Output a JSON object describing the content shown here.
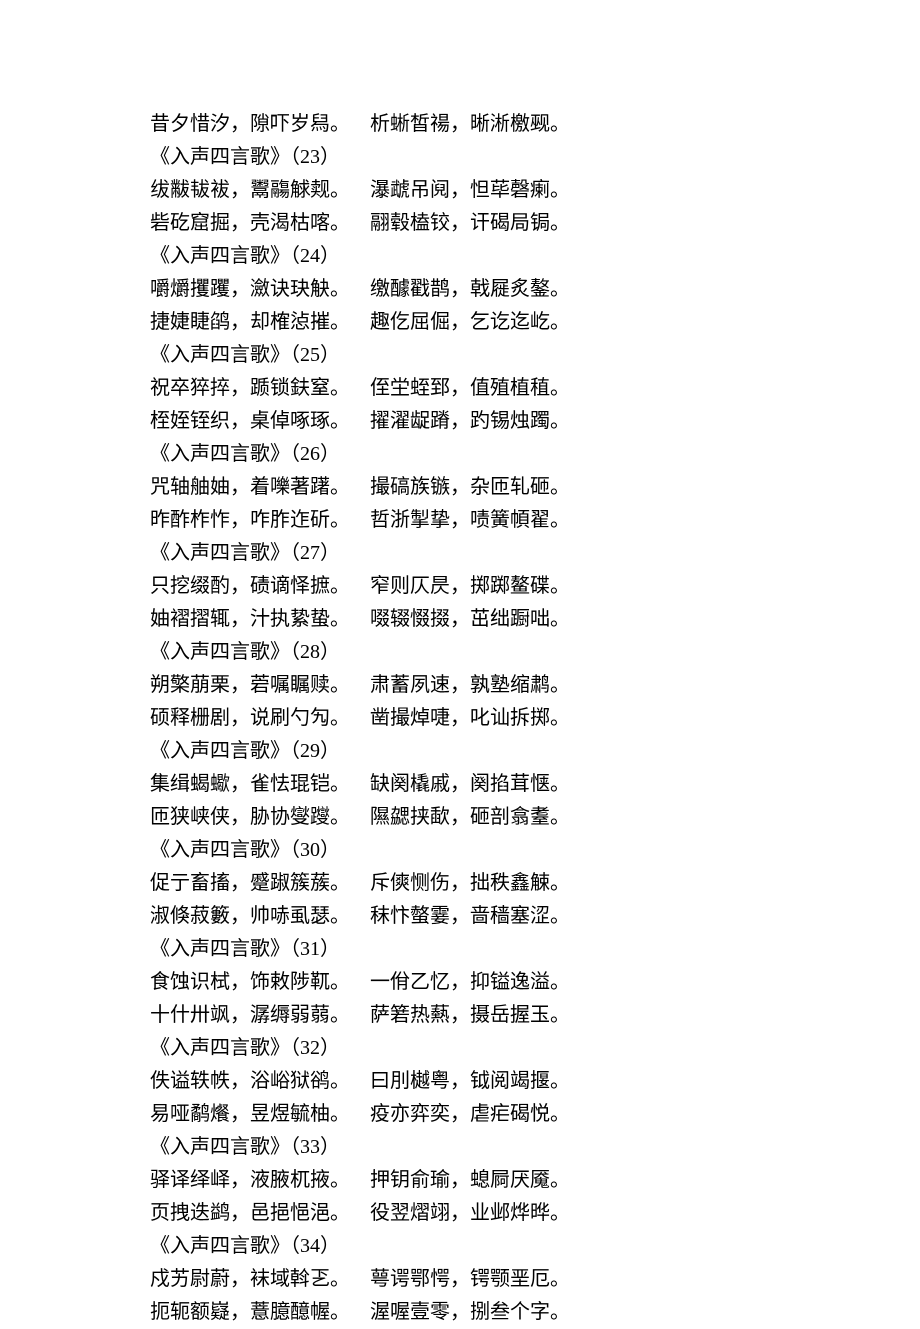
{
  "lines": [
    {
      "type": "verse",
      "a": "昔夕惜汐，隙吓岁舄。",
      "b": "析蜥皙禓，晰淅檄觋。"
    },
    {
      "type": "title",
      "text": "《入声四言歌》（23）"
    },
    {
      "type": "verse",
      "a": "绂黻韨袚，鬻鬺觩觌。",
      "b": "瀑虣吊阋，怛荜磬瘌。"
    },
    {
      "type": "verse",
      "a": "砦矻窟掘，壳渴枯喀。",
      "b": "翮毂榼铰，讦碣局锔。"
    },
    {
      "type": "title",
      "text": "《入声四言歌》（24）"
    },
    {
      "type": "verse",
      "a": "嚼爝攫躩，瀲诀玦觖。",
      "b": "缴醵戳鹊，戟屣炙鏊。"
    },
    {
      "type": "verse",
      "a": "捷婕睫鹐，却榷惉摧。",
      "b": "趣仡屈倔，乞讫迄屹。"
    },
    {
      "type": "title",
      "text": "《入声四言歌》（25）"
    },
    {
      "type": "verse",
      "a": "祝卒猝捽，踬锁鈇窒。",
      "b": "侄坣蛭郅，值殖植稙。"
    },
    {
      "type": "verse",
      "a": "桎姪铚织，桌倬啄琢。",
      "b": "擢濯龊蹐，趵锡烛躅。"
    },
    {
      "type": "title",
      "text": "《入声四言歌》（26）"
    },
    {
      "type": "verse",
      "a": "咒轴舳妯，着嚛著躇。",
      "b": "撮碻族镞，杂匝轧砸。"
    },
    {
      "type": "verse",
      "a": "昨酢柞怍，咋胙迮斫。",
      "b": "哲浙掣挚，啧簧幁翟。"
    },
    {
      "type": "title",
      "text": "《入声四言歌》（27）"
    },
    {
      "type": "verse",
      "a": "只挖缀酌，碛谪怿摭。",
      "b": "窄则仄昃，掷踯鳌碟。"
    },
    {
      "type": "verse",
      "a": "妯褶摺辄，汁执絷蛰。",
      "b": "啜辍惙掇，茁绌蹰咄。"
    },
    {
      "type": "title",
      "text": "《入声四言歌》（28）"
    },
    {
      "type": "verse",
      "a": "朔檠萠栗，菪嘱瞩赎。",
      "b": "肃蓄夙速，孰塾缩鹔。"
    },
    {
      "type": "verse",
      "a": "硕释栅剧，说刷勺勼。",
      "b": "凿撮焯啑，叱讪拆掷。"
    },
    {
      "type": "title",
      "text": "《入声四言歌》（29）"
    },
    {
      "type": "verse",
      "a": "集缉蝎蠍，雀怯琨铠。",
      "b": "缺阕橇戚，阕掐茸惬。"
    },
    {
      "type": "verse",
      "a": "匝狭峡侠，胁协燮躞。",
      "b": "隰勰挟歃，砸剖翕耋。"
    },
    {
      "type": "title",
      "text": "《入声四言歌》（30）"
    },
    {
      "type": "verse",
      "a": "促亍畜搐，蹙踧簇蔟。",
      "b": "斥傸恻伤，拙秩鑫觫。"
    },
    {
      "type": "verse",
      "a": "淑倏菽籔，帅哧虱瑟。",
      "b": "秣忭螫霎，啬穑塞涩。"
    },
    {
      "type": "title",
      "text": "《入声四言歌》（31）"
    },
    {
      "type": "verse",
      "a": "食蚀识栻，饰敕陟靰。",
      "b": "一佾乙忆，抑镒逸溢。"
    },
    {
      "type": "verse",
      "a": "十什卅飒，潺缛弱蒻。",
      "b": "萨箬热爇，摄岳握玉。"
    },
    {
      "type": "title",
      "text": "《入声四言歌》（32）"
    },
    {
      "type": "verse",
      "a": "佚谥轶帙，浴峪狱鹆。",
      "b": "曰刖樾粤，钺阅竭揠。"
    },
    {
      "type": "verse",
      "a": "易哑鹬爘，昱煜毓柚。",
      "b": "疫亦弈奕，虐疟碣悦。"
    },
    {
      "type": "title",
      "text": "《入声四言歌》（33）"
    },
    {
      "type": "verse",
      "a": "驿译绎峄，液腋杌掖。",
      "b": "押钥俞瑜，螅屙厌魇。"
    },
    {
      "type": "verse",
      "a": "页拽迭鹢，邑挹悒浥。",
      "b": "役翌熠翊，业邺烨晔。"
    },
    {
      "type": "title",
      "text": "《入声四言歌》（34）"
    },
    {
      "type": "verse",
      "a": "戍艻尉蔚，袜域斡乤。",
      "b": "萼谔鄂愕，锷颚垩厄。"
    },
    {
      "type": "verse",
      "a": "扼轭额嶷，薏臆醷幄。",
      "b": "渥喔壹零，捌叁个字。"
    }
  ]
}
